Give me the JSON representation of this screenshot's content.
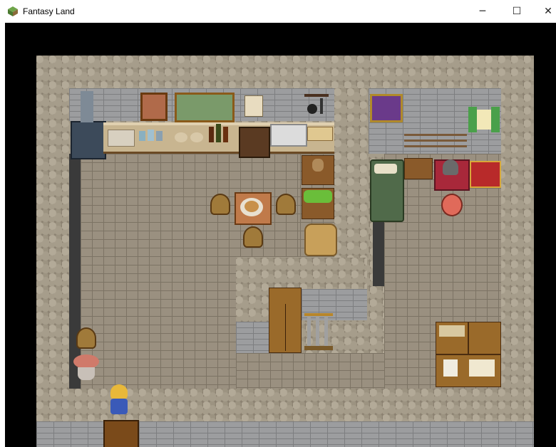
{
  "window": {
    "title": "Fantasy Land",
    "minimize_glyph": "─",
    "maximize_glyph": "☐",
    "close_glyph": "✕"
  },
  "colors": {
    "background": "#000000",
    "cobblestone": "#8a8070",
    "floor_tile": "#9a9080",
    "wall_brick": "#9c9d9f",
    "wood": "#8a5a2a"
  },
  "map": {
    "name": "Fantasy Land",
    "rooms": [
      "kitchen",
      "armory",
      "storage",
      "study"
    ]
  },
  "player": {
    "hair": "blond",
    "outfit": "blue"
  },
  "icons": [
    "game-app-icon",
    "stove-icon",
    "painting-icon",
    "sink-icon",
    "barrel-icon",
    "bed-icon",
    "chest-icon",
    "helmet-icon",
    "wardrobe-icon",
    "weapon-rack-icon",
    "bookshelf-icon",
    "flower-pot-icon",
    "stool-icon",
    "table-icon",
    "door-icon"
  ]
}
